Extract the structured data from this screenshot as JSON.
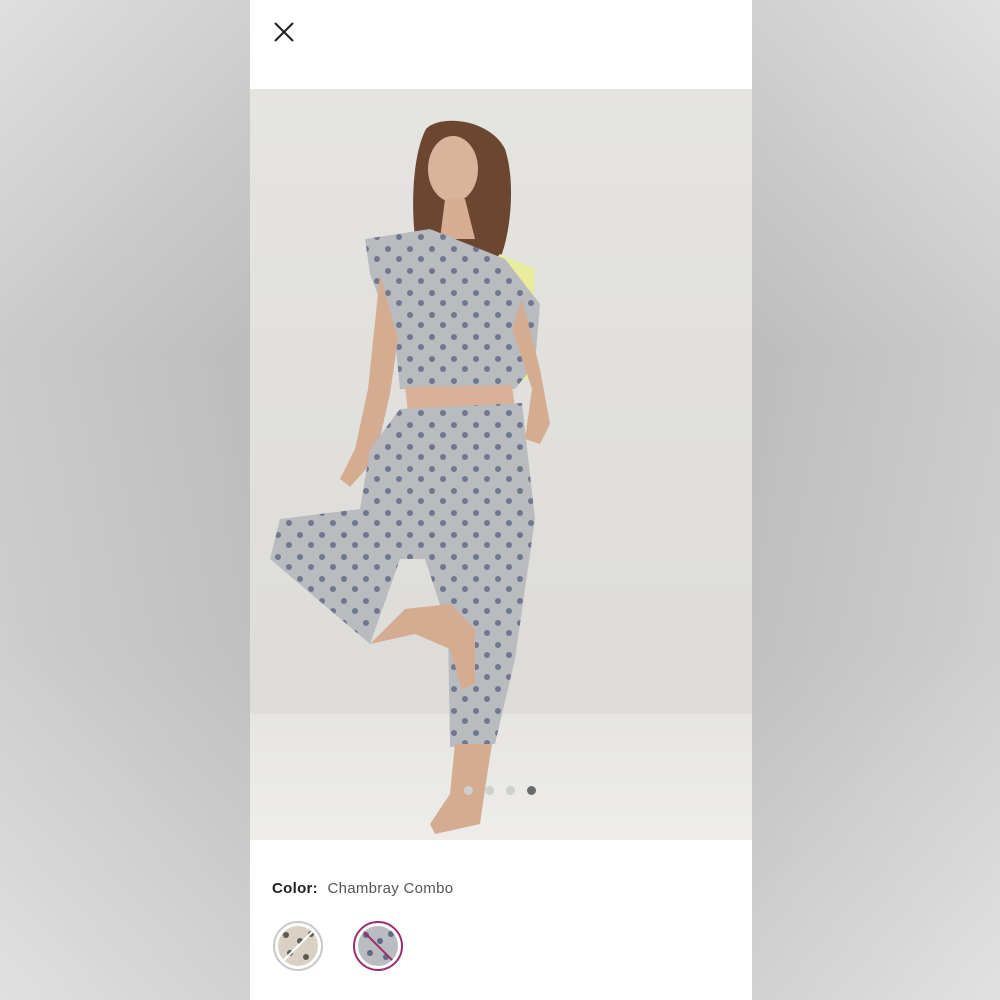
{
  "header": {
    "close_icon": "close-icon"
  },
  "product_image": {
    "alt": "Model wearing printed cropped tee and jogger set",
    "slide_count": 4,
    "active_slide": 4
  },
  "color": {
    "label": "Color:",
    "value": "Chambray Combo"
  },
  "swatches": [
    {
      "name": "swatch-1",
      "state": "available",
      "pattern_color": "#d9d2c4"
    },
    {
      "name": "swatch-2",
      "state": "selected-crossed",
      "pattern_color": "#b9bdc2",
      "ring_color": "#9c2e6b"
    }
  ],
  "colors": {
    "panel_bg": "#ffffff",
    "dot_active": "#6a6a6a",
    "dot_inactive": "#cfcfcf"
  }
}
